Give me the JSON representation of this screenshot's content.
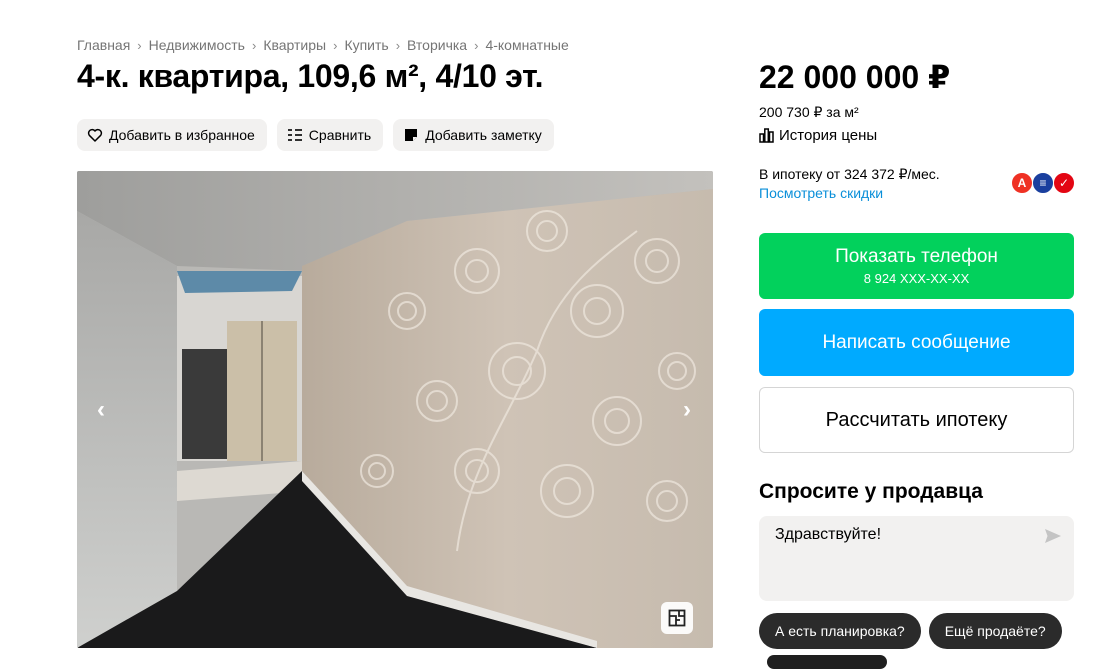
{
  "breadcrumb": [
    "Главная",
    "Недвижимость",
    "Квартиры",
    "Купить",
    "Вторичка",
    "4-комнатные"
  ],
  "title": "4-к. квартира, 109,6 м², 4/10 эт.",
  "actions": {
    "favorite": "Добавить в избранное",
    "compare": "Сравнить",
    "note": "Добавить заметку"
  },
  "gallery": {
    "prev_icon": "chevron-left-icon",
    "next_icon": "chevron-right-icon",
    "plan_icon": "floor-plan-icon"
  },
  "price": {
    "total": "22 000 000 ₽",
    "per_sqm": "200 730 ₽ за м²",
    "history": "История цены"
  },
  "mortgage": {
    "text": "В ипотеку от 324 372 ₽/мес.",
    "link": "Посмотреть скидки",
    "banks": [
      {
        "icon": "alfa-bank-icon",
        "letter": "А",
        "color": "#ef3124"
      },
      {
        "icon": "bank-blue-icon",
        "letter": "≡",
        "color": "#1a3f9e"
      },
      {
        "icon": "bank-red-icon",
        "letter": "✓",
        "color": "#e30613"
      }
    ]
  },
  "buttons": {
    "phone_label": "Показать телефон",
    "phone_masked": "8 924 XXX-XX-XX",
    "message": "Написать сообщение",
    "mortgage_calc": "Рассчитать ипотеку"
  },
  "ask": {
    "title": "Спросите у продавца",
    "input_value": "Здравствуйте!",
    "chips": [
      "А есть планировка?",
      "Ещё продаёте?"
    ]
  },
  "colors": {
    "green": "#02d15c",
    "blue": "#00aaff",
    "link": "#0a8fd9"
  }
}
